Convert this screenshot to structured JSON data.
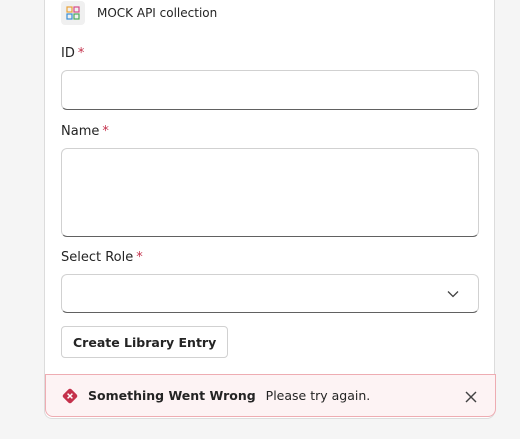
{
  "header": {
    "app_icon": "app-grid-icon",
    "title": "MOCK API collection"
  },
  "form": {
    "id_field": {
      "label": "ID",
      "required_mark": "*",
      "value": ""
    },
    "name_field": {
      "label": "Name",
      "required_mark": "*",
      "value": ""
    },
    "role_field": {
      "label": "Select Role",
      "required_mark": "*",
      "value": "",
      "icon": "chevron-down-icon"
    },
    "submit_label": "Create Library Entry"
  },
  "alert": {
    "icon": "error-icon",
    "title": "Something Went Wrong",
    "message": "Please try again.",
    "close_icon": "close-icon"
  },
  "colors": {
    "required": "#c4314b",
    "error": "#c4314b",
    "alert_background": "#fdf3f4",
    "alert_border": "#eeacb2"
  }
}
